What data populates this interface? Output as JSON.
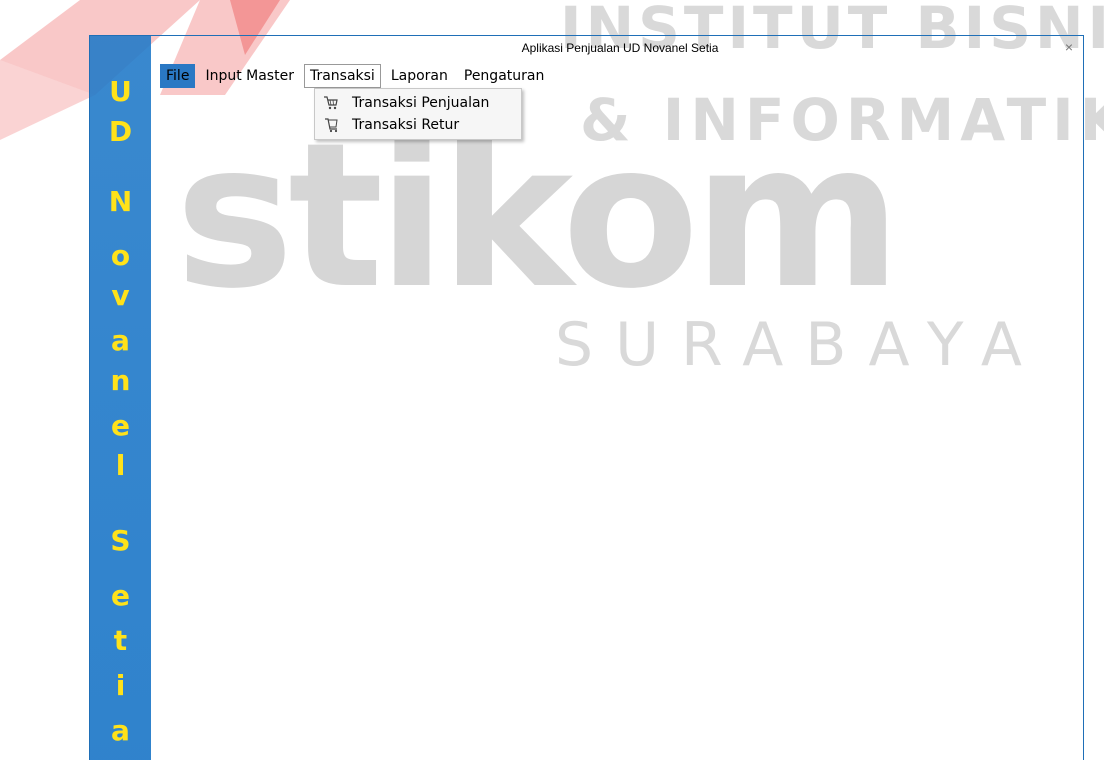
{
  "watermark": {
    "line1": "INSTITUT BISNIS",
    "line2": "& INFORMATIKA",
    "brand": "stikom",
    "city": "SURABAYA"
  },
  "window": {
    "title": "Aplikasi Penjualan UD Novanel Setia",
    "close_glyph": "×"
  },
  "side_banner": {
    "letters": [
      "U",
      "D",
      "N",
      "o",
      "v",
      "a",
      "n",
      "e",
      "l",
      "S",
      "e",
      "t",
      "i",
      "a"
    ]
  },
  "menu": {
    "file": "File",
    "input_master": "Input Master",
    "transaksi": "Transaksi",
    "laporan": "Laporan",
    "pengaturan": "Pengaturan"
  },
  "dropdown": {
    "items": [
      {
        "label": "Transaksi Penjualan",
        "icon": "shopping-cart-icon"
      },
      {
        "label": "Transaksi Retur",
        "icon": "return-cart-icon"
      }
    ]
  },
  "colors": {
    "banner_blue": "#1e78c8",
    "banner_letter": "#ffe21a",
    "menu_highlight": "#2a78c4",
    "watermark_red": "#e83838",
    "watermark_gray": "#d4d4d4"
  }
}
